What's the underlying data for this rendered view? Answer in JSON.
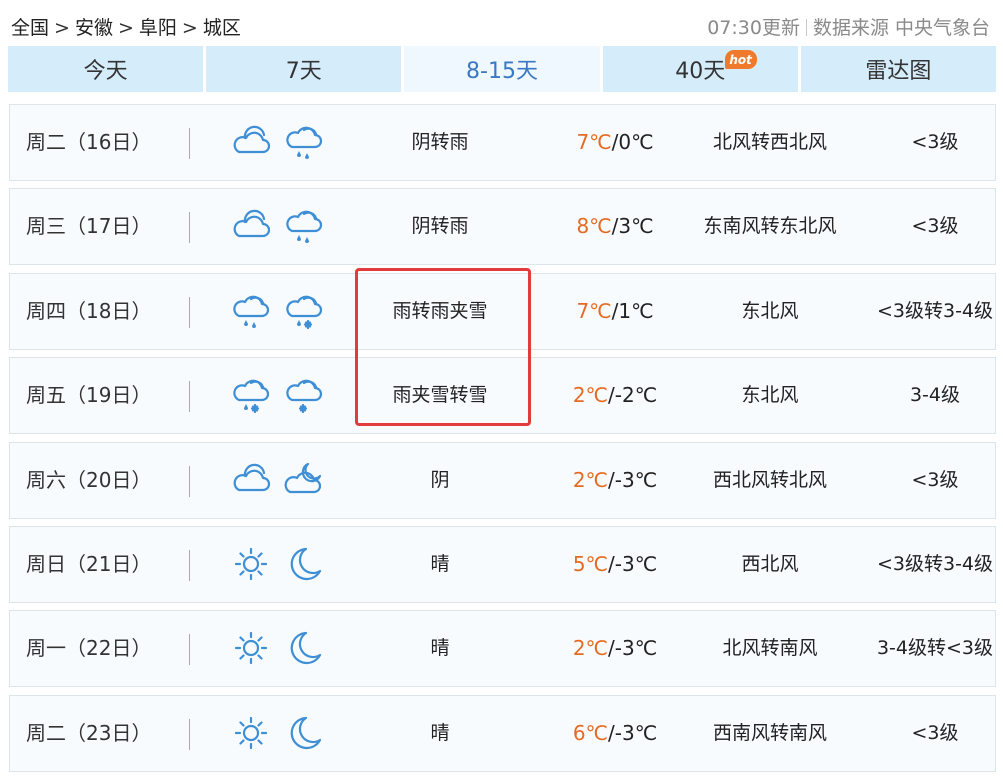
{
  "breadcrumb": {
    "items": [
      "全国",
      "安徽",
      "阜阳",
      "城区"
    ],
    "separator": ">"
  },
  "header": {
    "update_time": "07:30更新",
    "source": "数据来源 中央气象台"
  },
  "tabs": [
    {
      "label": "今天"
    },
    {
      "label": "7天"
    },
    {
      "label": "8-15天"
    },
    {
      "label": "40天",
      "badge": "hot"
    },
    {
      "label": "雷达图"
    }
  ],
  "colors": {
    "accent": "#3a78c4",
    "tab_bg": "#d5ecfb",
    "high_temp": "#e56a22",
    "highlight": "#e23b3b",
    "icon": "#3f8fd6"
  },
  "forecast": [
    {
      "day": "周二（16日）",
      "icon_day": "cloud-icon",
      "icon_night": "rain-cloud-icon",
      "desc": "阴转雨",
      "high": "7℃",
      "low": "/0℃",
      "wind": "北风转西北风",
      "level": "<3级"
    },
    {
      "day": "周三（17日）",
      "icon_day": "cloud-icon",
      "icon_night": "rain-cloud-icon",
      "desc": "阴转雨",
      "high": "8℃",
      "low": "/3℃",
      "wind": "东南风转东北风",
      "level": "<3级"
    },
    {
      "day": "周四（18日）",
      "icon_day": "rain-cloud-icon",
      "icon_night": "sleet-cloud-icon",
      "desc": "雨转雨夹雪",
      "high": "7℃",
      "low": "/1℃",
      "wind": "东北风",
      "level": "<3级转3-4级"
    },
    {
      "day": "周五（19日）",
      "icon_day": "sleet-cloud-icon",
      "icon_night": "snow-cloud-icon",
      "desc": "雨夹雪转雪",
      "high": "2℃",
      "low": "/-2℃",
      "wind": "东北风",
      "level": "3-4级"
    },
    {
      "day": "周六（20日）",
      "icon_day": "cloud-icon",
      "icon_night": "cloudy-night-icon",
      "desc": "阴",
      "high": "2℃",
      "low": "/-3℃",
      "wind": "西北风转北风",
      "level": "<3级"
    },
    {
      "day": "周日（21日）",
      "icon_day": "sun-icon",
      "icon_night": "moon-icon",
      "desc": "晴",
      "high": "5℃",
      "low": "/-3℃",
      "wind": "西北风",
      "level": "<3级转3-4级"
    },
    {
      "day": "周一（22日）",
      "icon_day": "sun-icon",
      "icon_night": "moon-icon",
      "desc": "晴",
      "high": "2℃",
      "low": "/-3℃",
      "wind": "北风转南风",
      "level": "3-4级转<3级"
    },
    {
      "day": "周二（23日）",
      "icon_day": "sun-icon",
      "icon_night": "moon-icon",
      "desc": "晴",
      "high": "6℃",
      "low": "/-3℃",
      "wind": "西南风转南风",
      "level": "<3级"
    }
  ]
}
